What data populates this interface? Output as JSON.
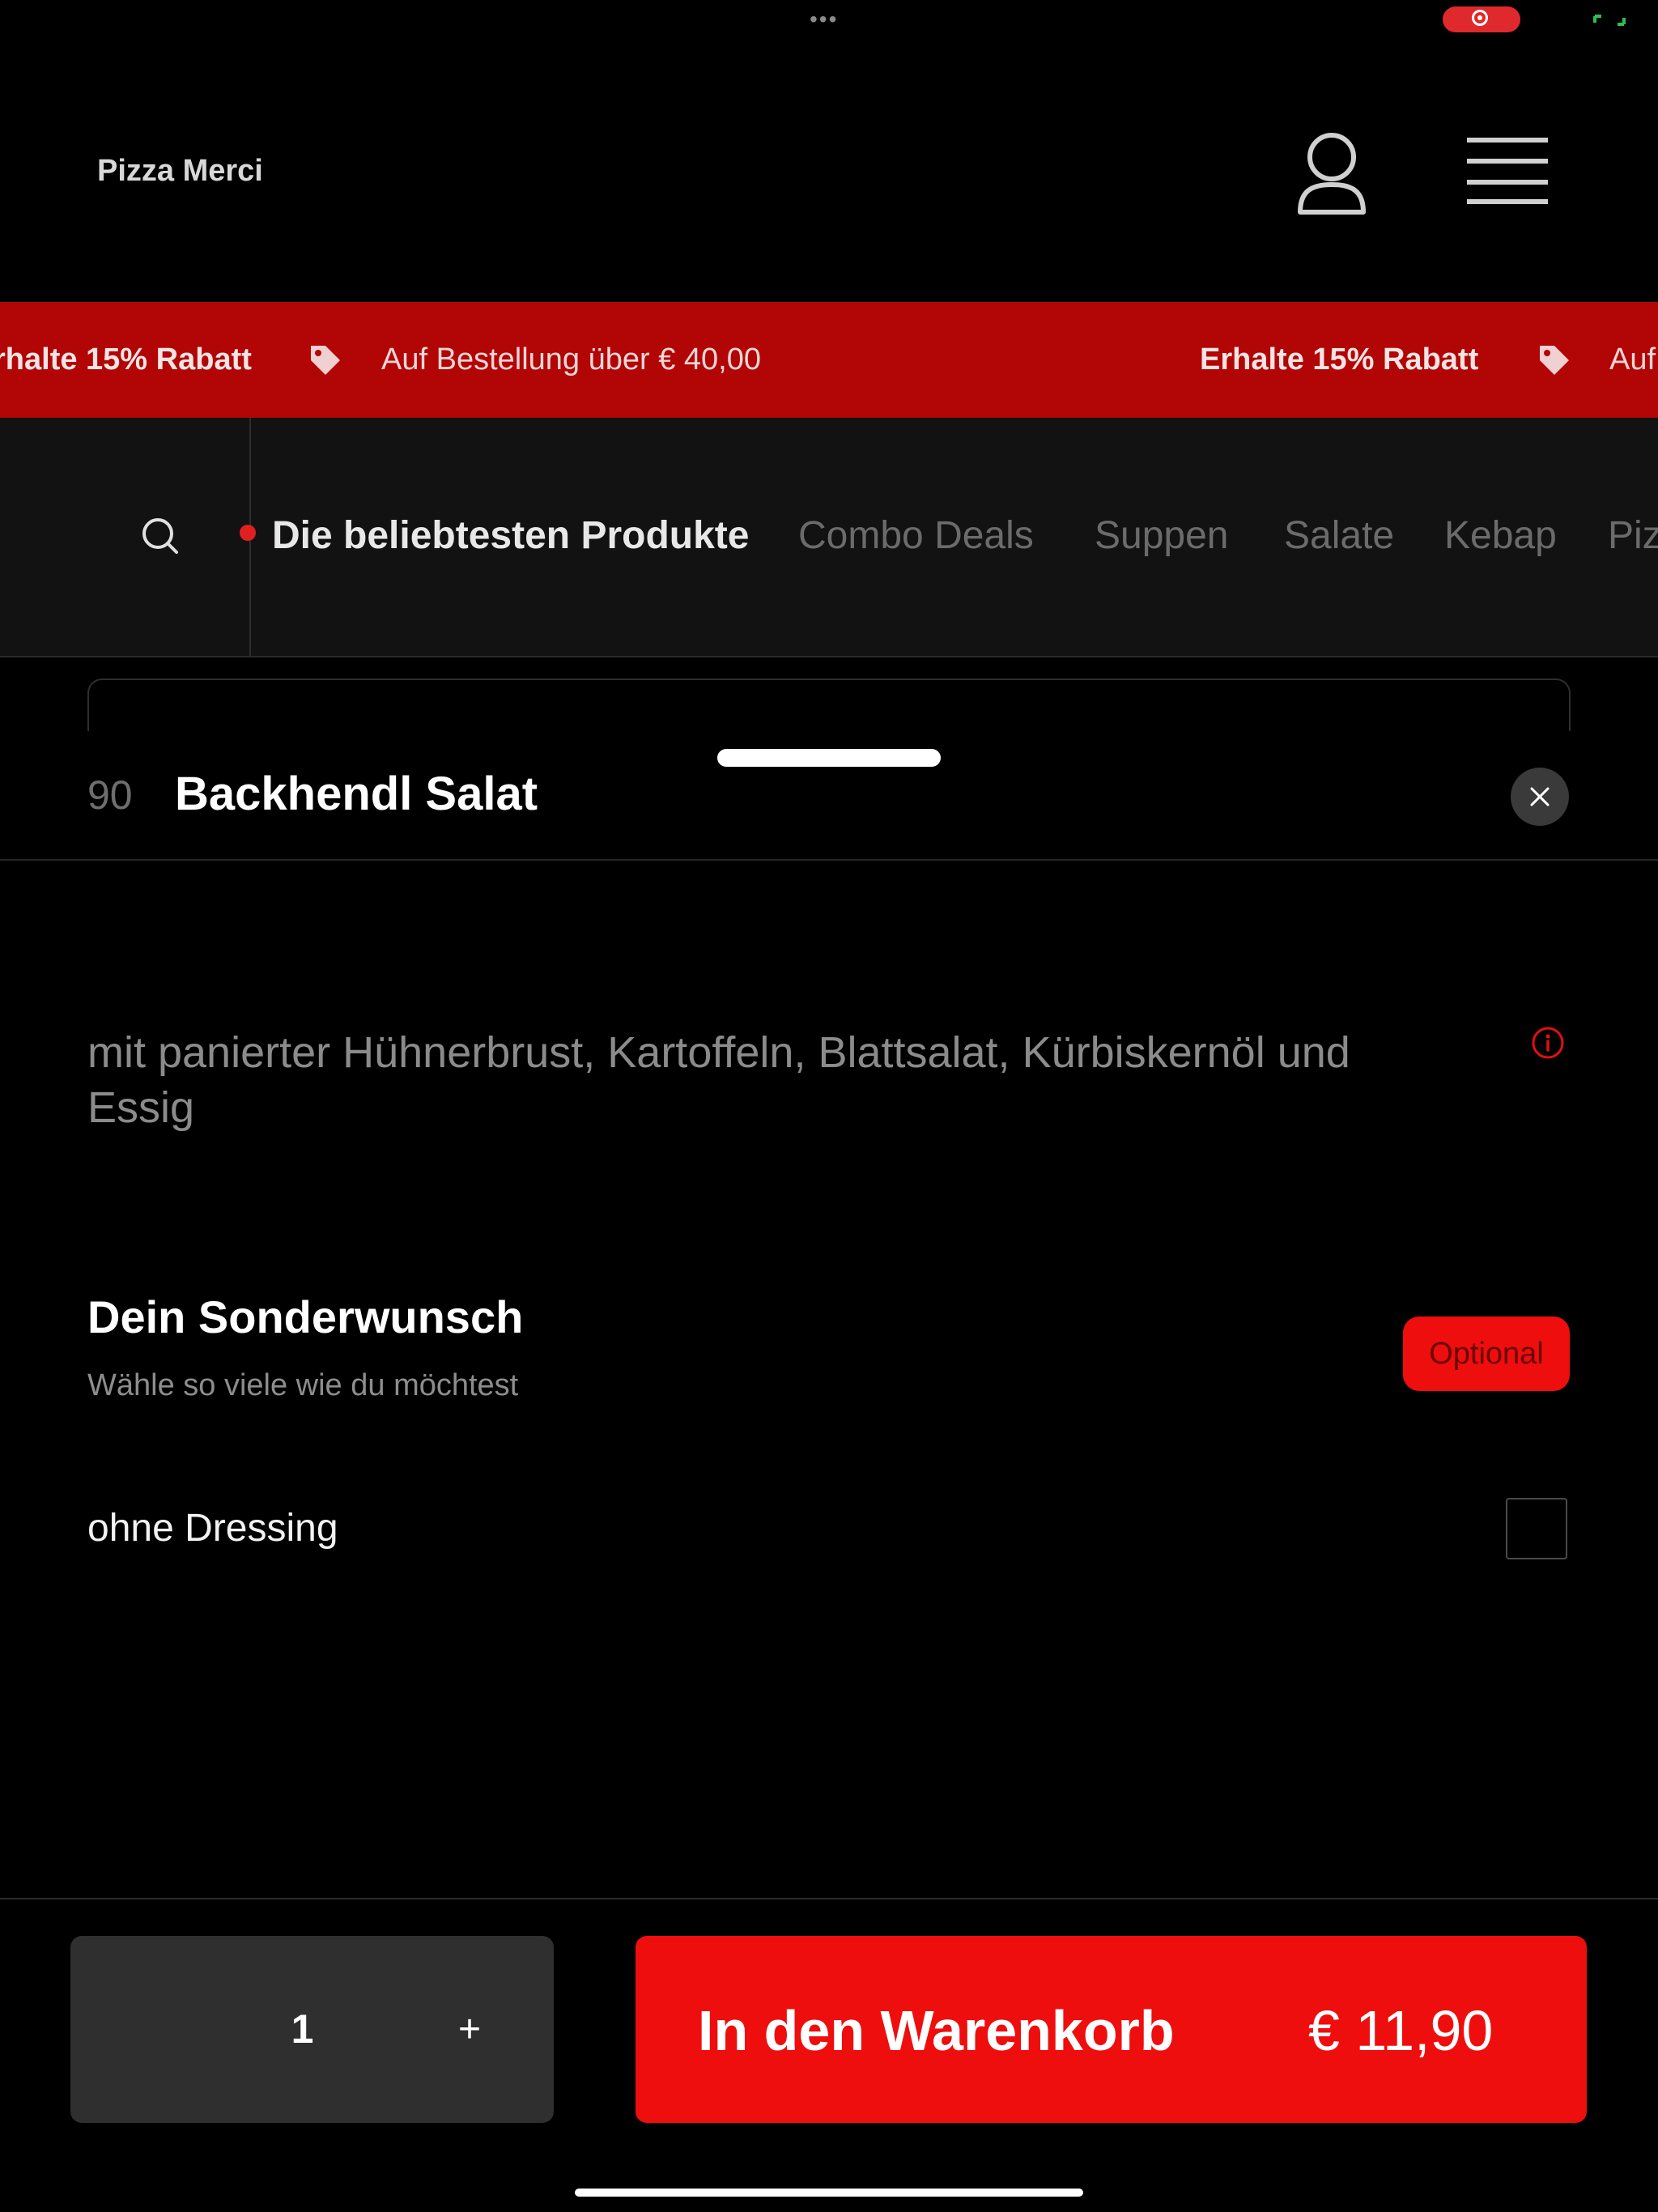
{
  "restaurant": {
    "name": "Pizza Merci"
  },
  "promo": {
    "items": [
      {
        "headline": "rhalte 15% Rabatt",
        "detail": "Auf Bestellung über € 40,00"
      },
      {
        "headline": "Erhalte 15% Rabatt",
        "detail": "Auf"
      }
    ]
  },
  "categories": [
    {
      "label": "Die beliebtesten Produkte",
      "active": true
    },
    {
      "label": "Combo Deals",
      "active": false
    },
    {
      "label": "Suppen",
      "active": false
    },
    {
      "label": "Salate",
      "active": false
    },
    {
      "label": "Kebap",
      "active": false
    },
    {
      "label": "Piz",
      "active": false
    }
  ],
  "item": {
    "number": "90",
    "title": "Backhendl Salat",
    "description": "mit panierter Hühnerbrust, Kartoffeln, Blattsalat, Kürbiskernöl und Essig"
  },
  "options": {
    "title": "Dein Sonderwunsch",
    "subtitle": "Wähle so viele wie du möchtest",
    "badge": "Optional",
    "choices": [
      {
        "label": "ohne Dressing",
        "checked": false
      }
    ]
  },
  "footer": {
    "quantity": "1",
    "plus_label": "+",
    "add_label": "In den Warenkorb",
    "price": "€ 11,90"
  },
  "colors": {
    "accent": "#ee0e0e",
    "banner": "#b20505",
    "background": "#000000"
  },
  "icons": {
    "user": "user-icon",
    "menu": "menu-icon",
    "search": "search-icon",
    "tag": "tag-icon",
    "close": "close-icon",
    "info": "info-icon"
  }
}
